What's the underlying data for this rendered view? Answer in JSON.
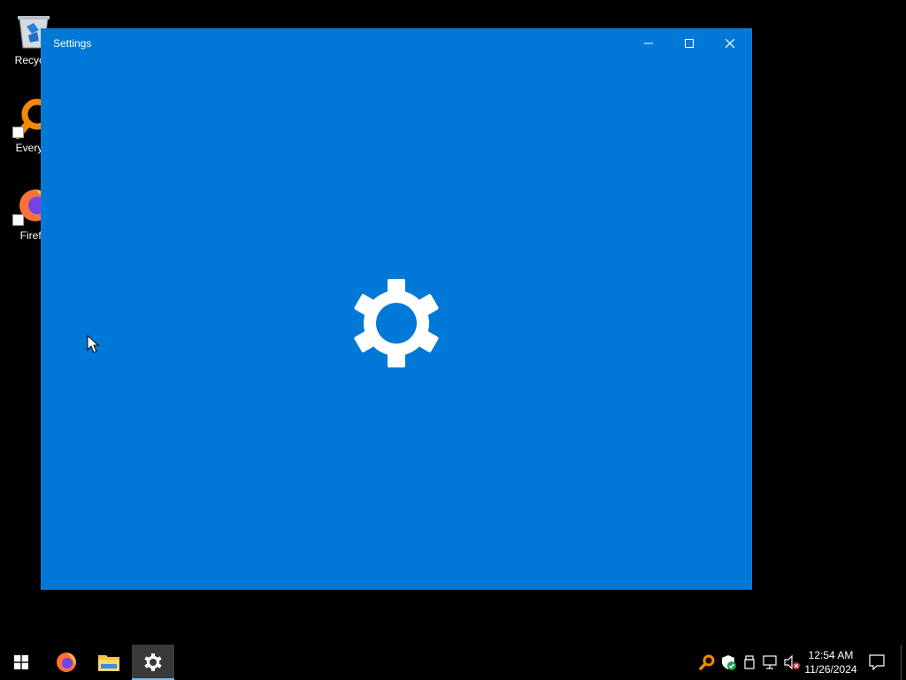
{
  "desktop": {
    "icons": [
      {
        "label": "Recycle",
        "icon": "recycle-bin-icon"
      },
      {
        "label": "Everyth",
        "icon": "everything-search-icon"
      },
      {
        "label": "Firefo",
        "icon": "firefox-icon"
      }
    ]
  },
  "window": {
    "title": "Settings",
    "background": "#0078d7",
    "controls": [
      "minimize-icon",
      "maximize-icon",
      "close-icon"
    ],
    "splash_icon": "gear-icon"
  },
  "taskbar": {
    "apps": [
      {
        "name": "Start",
        "icon": "windows-start-icon"
      },
      {
        "name": "Firefox",
        "icon": "firefox-icon"
      },
      {
        "name": "File Explorer",
        "icon": "file-explorer-icon"
      },
      {
        "name": "Settings",
        "icon": "gear-icon",
        "active": true
      }
    ],
    "tray": [
      "everything-search-icon",
      "windows-security-icon",
      "usb-icon",
      "network-icon",
      "volume-muted-icon"
    ],
    "clock": {
      "time": "12:54 AM",
      "date": "11/26/2024"
    },
    "notifications_icon": "notification-icon"
  }
}
